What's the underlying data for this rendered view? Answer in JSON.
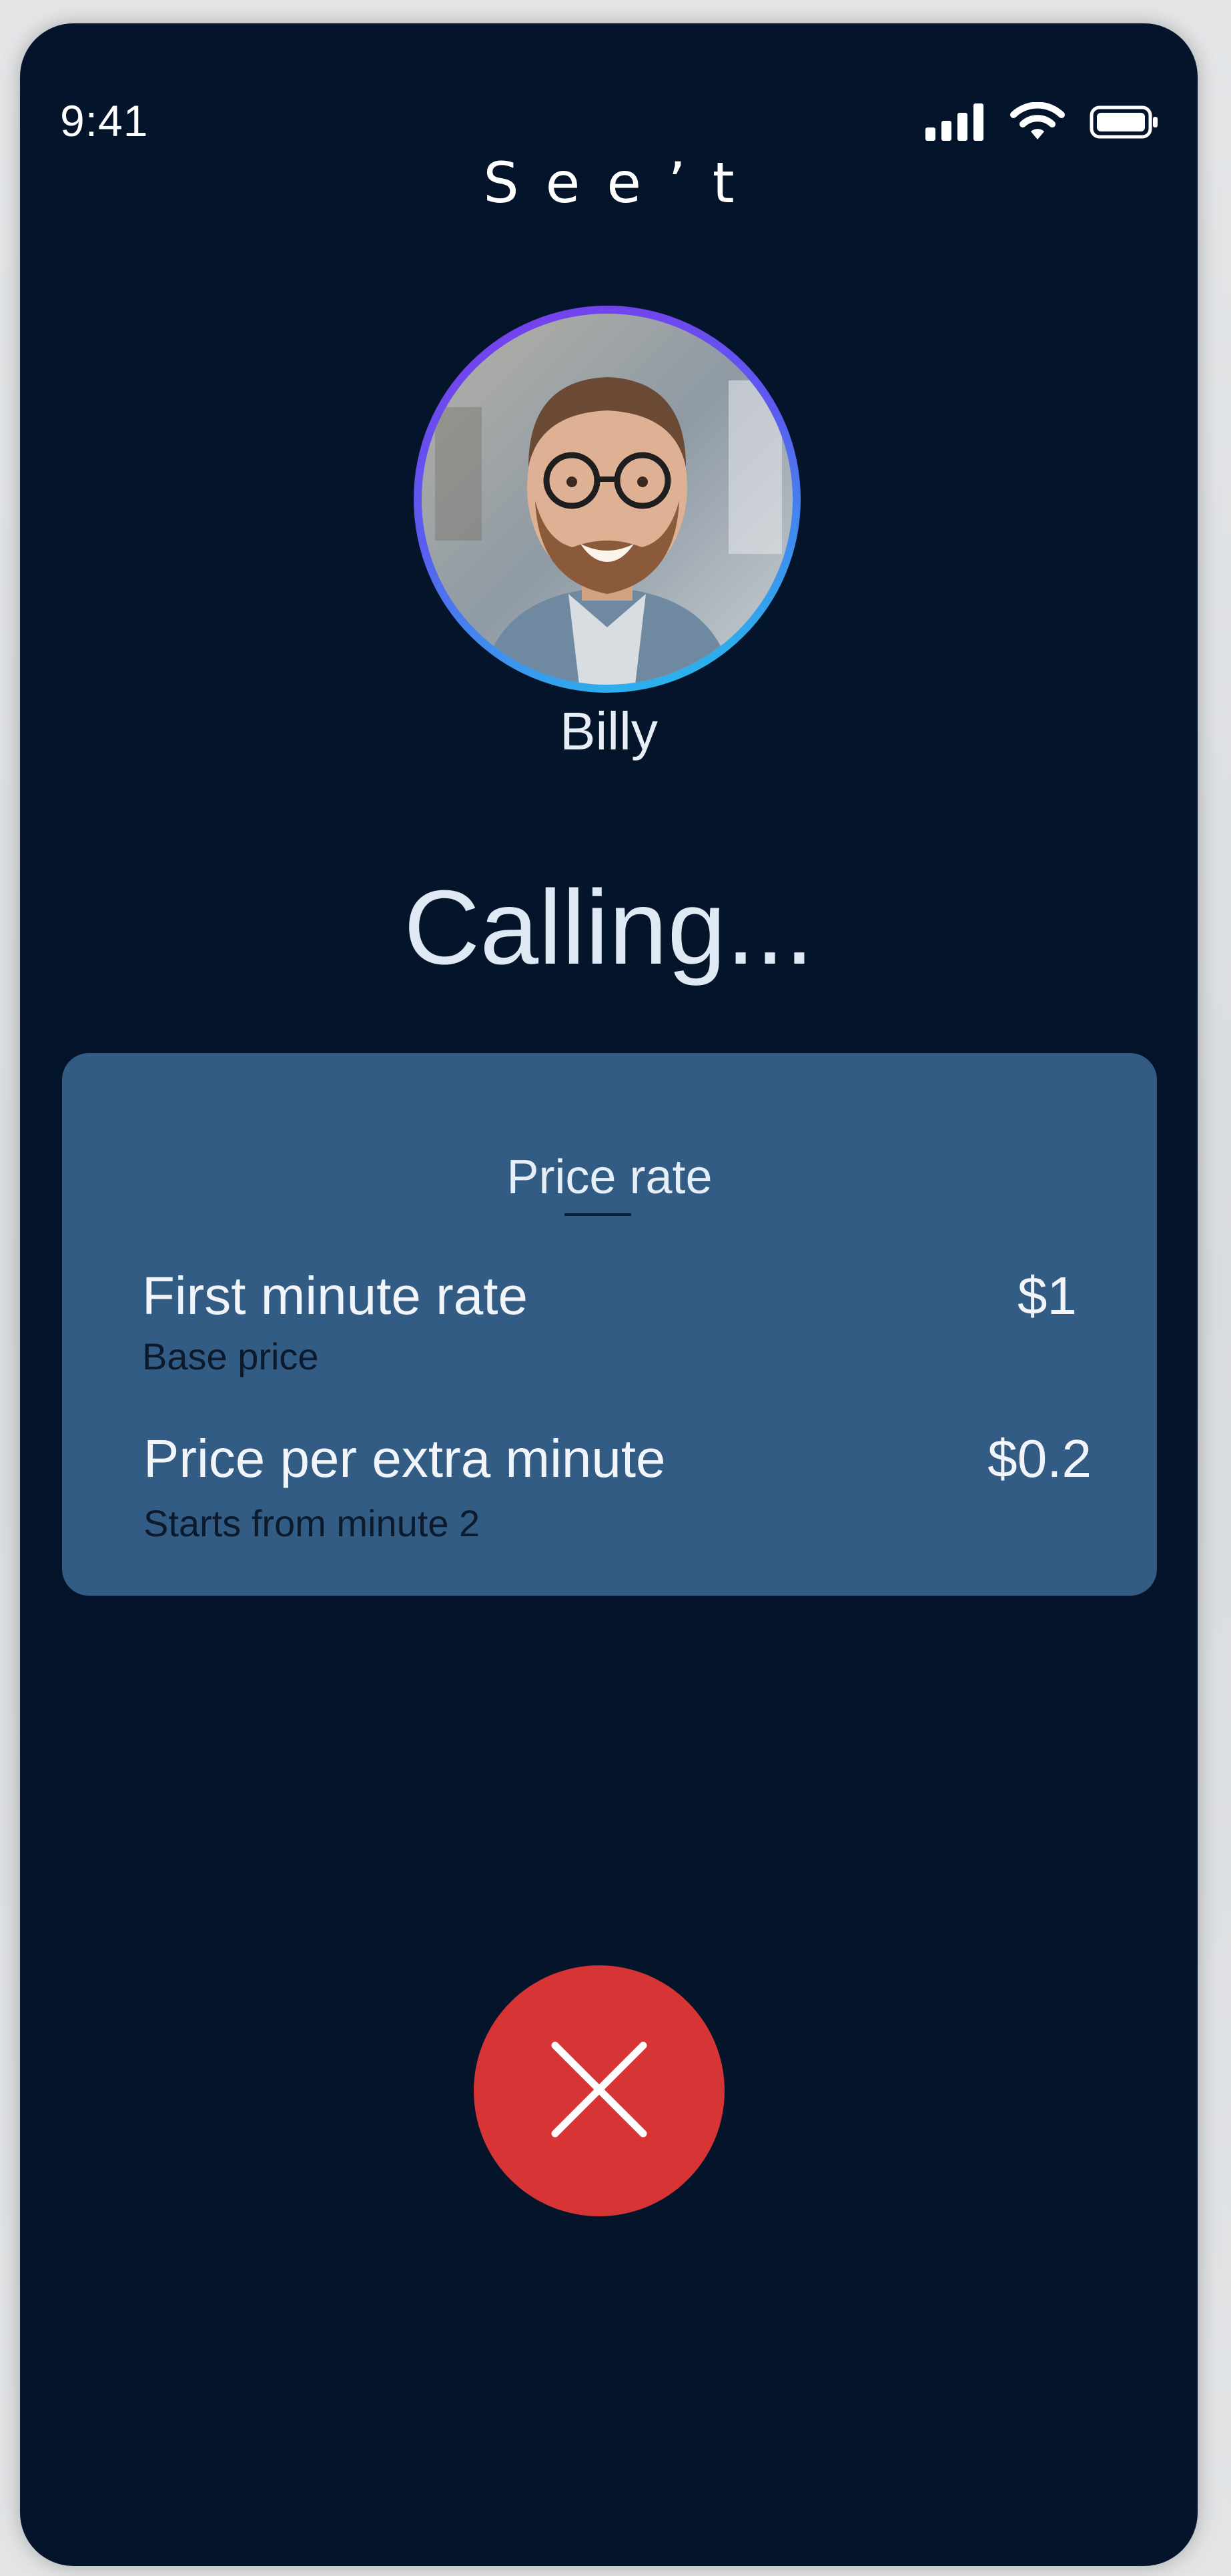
{
  "status_bar": {
    "time": "9:41",
    "icons": [
      "signal-icon",
      "wifi-icon",
      "battery-icon"
    ]
  },
  "app": {
    "logo_text": "Seeʼt"
  },
  "caller": {
    "name": "Billy",
    "avatar": "user-avatar-photo"
  },
  "call": {
    "status": "Calling..."
  },
  "price_rate": {
    "title": "Price rate",
    "items": [
      {
        "label": "First minute rate",
        "sublabel": "Base price",
        "value": "$1"
      },
      {
        "label": "Price per extra minute",
        "sublabel": "Starts from minute 2",
        "value": "$0.2"
      }
    ]
  },
  "actions": {
    "end_call_icon": "close-icon"
  },
  "colors": {
    "background": "#04152b",
    "card": "#335c84",
    "end_call": "#d63435",
    "avatar_ring_start": "#7c3aed",
    "avatar_ring_end": "#1fc7ea"
  }
}
